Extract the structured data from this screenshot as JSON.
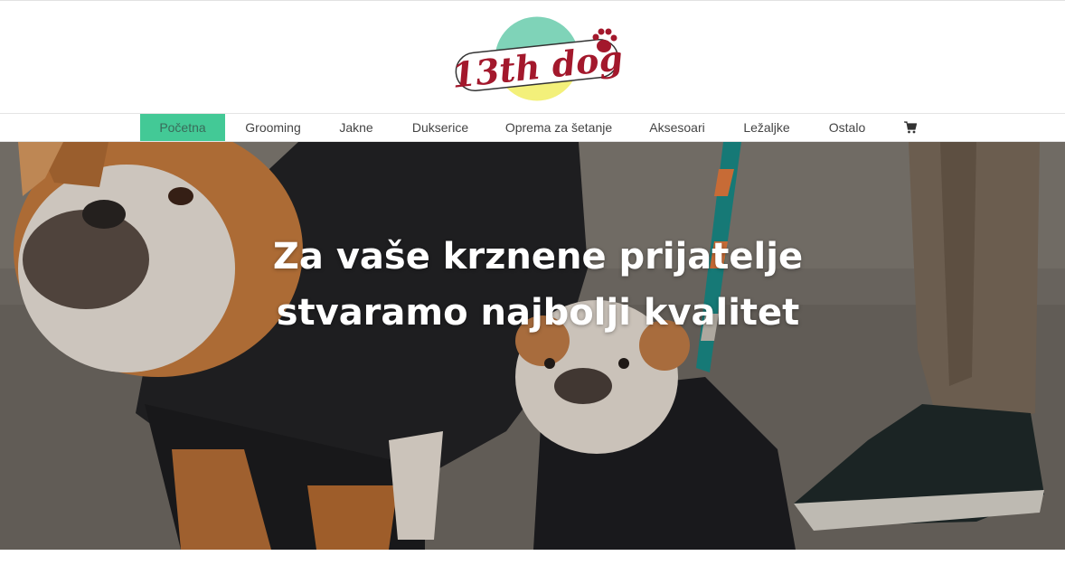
{
  "brand": {
    "logo_text": "13th dog",
    "colors": {
      "logo_red": "#a3182c",
      "logo_teal": "#7fd3b8",
      "logo_yellow": "#f3f07a",
      "accent": "#43c996"
    }
  },
  "nav": {
    "items": [
      {
        "label": "Početna",
        "active": true
      },
      {
        "label": "Grooming"
      },
      {
        "label": "Jakne"
      },
      {
        "label": "Dukserice"
      },
      {
        "label": "Oprema za šetanje"
      },
      {
        "label": "Aksesoari"
      },
      {
        "label": "Ležaljke"
      },
      {
        "label": "Ostalo"
      }
    ],
    "cart_icon": "shopping-cart-icon"
  },
  "hero": {
    "title_line1": "Za vaše krznene prijatelje",
    "title_line2": "stvaramo najbolji kvalitet",
    "image": "two-bulldogs-in-black-hoodies-on-leash"
  }
}
